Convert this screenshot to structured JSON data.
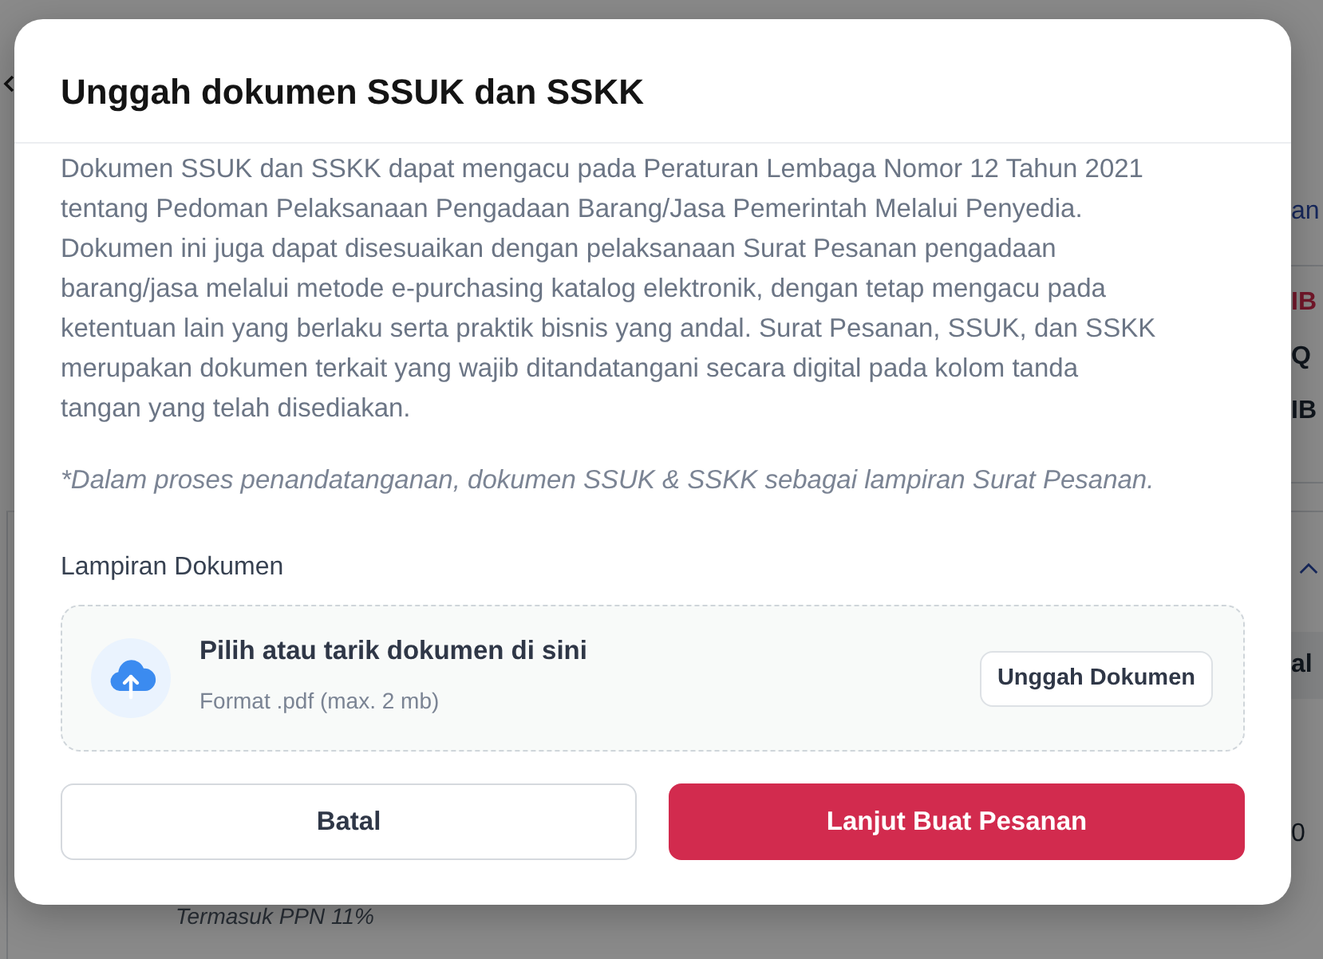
{
  "background": {
    "right_edge": {
      "link": "an",
      "codes": [
        {
          "text": "IB",
          "highlighted": true
        },
        {
          "text": "Q",
          "highlighted": false
        },
        {
          "text": "IB",
          "highlighted": false
        }
      ],
      "column_header": "al",
      "amount": "0"
    },
    "price_note": "Termasuk PPN 11%"
  },
  "modal": {
    "title": "Unggah dokumen SSUK dan SSKK",
    "description": "Dokumen SSUK dan SSKK dapat mengacu pada Peraturan Lembaga Nomor 12 Tahun 2021 tentang Pedoman Pelaksanaan Pengadaan Barang/Jasa Pemerintah Melalui Penyedia. Dokumen ini juga dapat disesuaikan dengan pelaksanaan Surat Pesanan pengadaan barang/jasa melalui metode e-purchasing katalog elektronik, dengan tetap mengacu pada ketentuan lain yang berlaku serta praktik bisnis yang andal. Surat Pesanan, SSUK, dan SSKK merupakan dokumen terkait yang wajib ditandatangani secara digital pada kolom tanda tangan yang telah disediakan.",
    "note": "*Dalam proses penandatanganan, dokumen SSUK & SSKK sebagai lampiran Surat Pesanan.",
    "attachment": {
      "label": "Lampiran Dokumen",
      "dropzone": {
        "title": "Pilih atau tarik dokumen di sini",
        "hint": "Format .pdf (max. 2 mb)",
        "button": "Unggah Dokumen"
      }
    },
    "buttons": [
      {
        "label": "Batal",
        "kind": "secondary"
      },
      {
        "label": "Lanjut Buat Pesanan",
        "kind": "primary"
      }
    ]
  }
}
